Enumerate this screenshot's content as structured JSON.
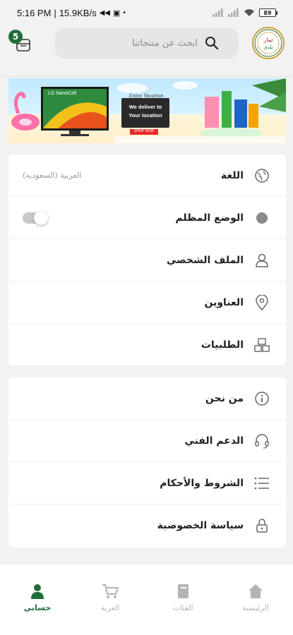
{
  "status_bar": {
    "time": "5:16 PM",
    "network_speed": "15.9KB/s",
    "battery": "89"
  },
  "header": {
    "cart_count": "5",
    "search_placeholder": "ابحث عن منتجاتنا",
    "logo_text": "ثمار بلدي"
  },
  "banner": {
    "tv_label": "LG NanoCell",
    "headline_1": "Enjoy Vacation",
    "headline_2": "We deliver to",
    "headline_3": "Your location",
    "cta": "SHOP NOW"
  },
  "settings": {
    "language_label": "اللغة",
    "language_value": "العربية (السعودية)",
    "dark_mode_label": "الوضع المظلم",
    "dark_mode_on": false,
    "profile_label": "الملف الشخصي",
    "addresses_label": "العناوين",
    "orders_label": "الطلبيات"
  },
  "info": {
    "about_label": "من نحن",
    "support_label": "الدعم الفني",
    "terms_label": "الشروط والأحكام",
    "privacy_label": "سياسة الخصوصية"
  },
  "bottom_nav": {
    "account": "حسابي",
    "cart": "العربة",
    "categories": "الفئات",
    "home": "الرئيسية"
  },
  "colors": {
    "brand_green": "#1f6e3a",
    "inactive_gray": "#b4b4b4"
  }
}
